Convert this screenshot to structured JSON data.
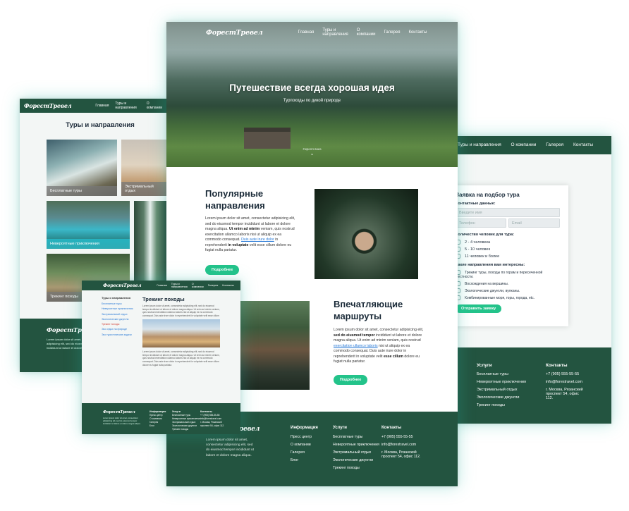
{
  "brand": {
    "logo": "ФорестТревел"
  },
  "nav": {
    "home": "Главная",
    "tours": "Туры и направления",
    "about": "О компании",
    "gallery": "Галерея",
    "contacts": "Контакты"
  },
  "hero": {
    "title": "Путешествие всегда хорошая идея",
    "subtitle": "Турпоходы по дикой природе",
    "scroll": "Скролл вниз"
  },
  "popular": {
    "title_line1": "Популярные",
    "title_line2": "направления",
    "text_p1": "Lorem ipsum dolor sit amet, consectetur adipisicing elit, sed do eiusmod tempor incididunt ut labore et dolore magna aliqua.",
    "text_b1": "Ut enim ad minim",
    "text_p2": "veniam, quis nostrud exercitation ullamco laboris nisi ut aliquip ex ea commodo consequat.",
    "text_link": "Duis aute irure dolor",
    "text_p3": "in reprehenderit",
    "text_b2": "in voluptate",
    "text_p4": "velit esse cillum dolore eu fugiat nulla pariatur.",
    "button": "Подробнее"
  },
  "routes": {
    "title_line1": "Впечатляющие",
    "title_line2": "маршруты",
    "text_p1": "Lorem ipsum dolor sit amet, consectetur adipisicing elit,",
    "text_b1": "sed do eiusmod tempor",
    "text_p2": "incididunt ut labore et dolore magna aliqua. Ut enim ad minim veniam, quis nostrud",
    "text_link": "exercitation ullamco laboris",
    "text_p3": "nisi ut aliquip ex ea commodo consequat. Duis aute irure dolor in reprehenderit in voluptate velit",
    "text_b2": "esse cillum",
    "text_p4": "dolore eu fugiat nulla pariatur.",
    "button": "Подробнее"
  },
  "footer": {
    "info_title": "Информация",
    "info_items": [
      "Пресс центр",
      "О компании",
      "Галерея",
      "Блог"
    ],
    "services_title": "Услуги",
    "services_items": [
      "Бесплатные туры",
      "Невероятные приключения",
      "Экстримальный отдых",
      "Экологические джунгли",
      "Трекинг походы"
    ],
    "contacts_title": "Контакты",
    "phone": "+7 (905) 555-55-55",
    "email": "info@forestravel.com",
    "address": "г. Москва, Рязанский проспект 54, офис 112.",
    "about_text": "Lorem ipsum dolor sit amet, consectetur adipisicing elit, sed do eiusmod tempor incididunt ut labore et dolore magna aliqua."
  },
  "tours_page": {
    "title": "Туры и направления",
    "cards": [
      "Бесплатные туры",
      "Экстримальный отдых",
      "Невероятные приключения",
      "",
      "Трекинг походы",
      ""
    ]
  },
  "trek_page": {
    "title": "Трекинг походы",
    "sidebar_title": "Туры и направления",
    "sidebar_items": [
      "Бесплатные туры",
      "Невероятные приключения",
      "Экстримальный отдых",
      "Экологические джунгли",
      "Трекинг походы",
      "Эко отдых на природе",
      "Эко туристические задачи"
    ],
    "lorem": "Lorem ipsum dolor sit amet, consectetur adipisicing elit, sed do eiusmod tempor incididunt ut labore et dolore magna aliqua. Ut enim ad minim veniam, quis nostrud exercitation ullamco laboris nisi ut aliquip ex ea commodo consequat. Duis aute irure dolor in reprehenderit in voluptate velit esse cillum dolore eu fugiat nulla pariatur."
  },
  "form_page": {
    "title": "Заявка на подбор тура",
    "contact_label": "Контактные данные:",
    "name_placeholder": "Введите имя",
    "phone_placeholder": "Телефон",
    "email_placeholder": "Email",
    "people_label": "Количество человек для тура:",
    "people_options": [
      "2 - 4 человека",
      "5 - 10 человек",
      "11 человек и более"
    ],
    "directions_label": "Какие направления вам интересны:",
    "directions_options": [
      "Трекинг туры, походы по горам и пересеченной местности.",
      "Восхождения на вершины.",
      "Экологические джунгли, вулканы.",
      "Комбинированные моря, горы, города, etc."
    ],
    "submit": "Отправить заявку"
  }
}
